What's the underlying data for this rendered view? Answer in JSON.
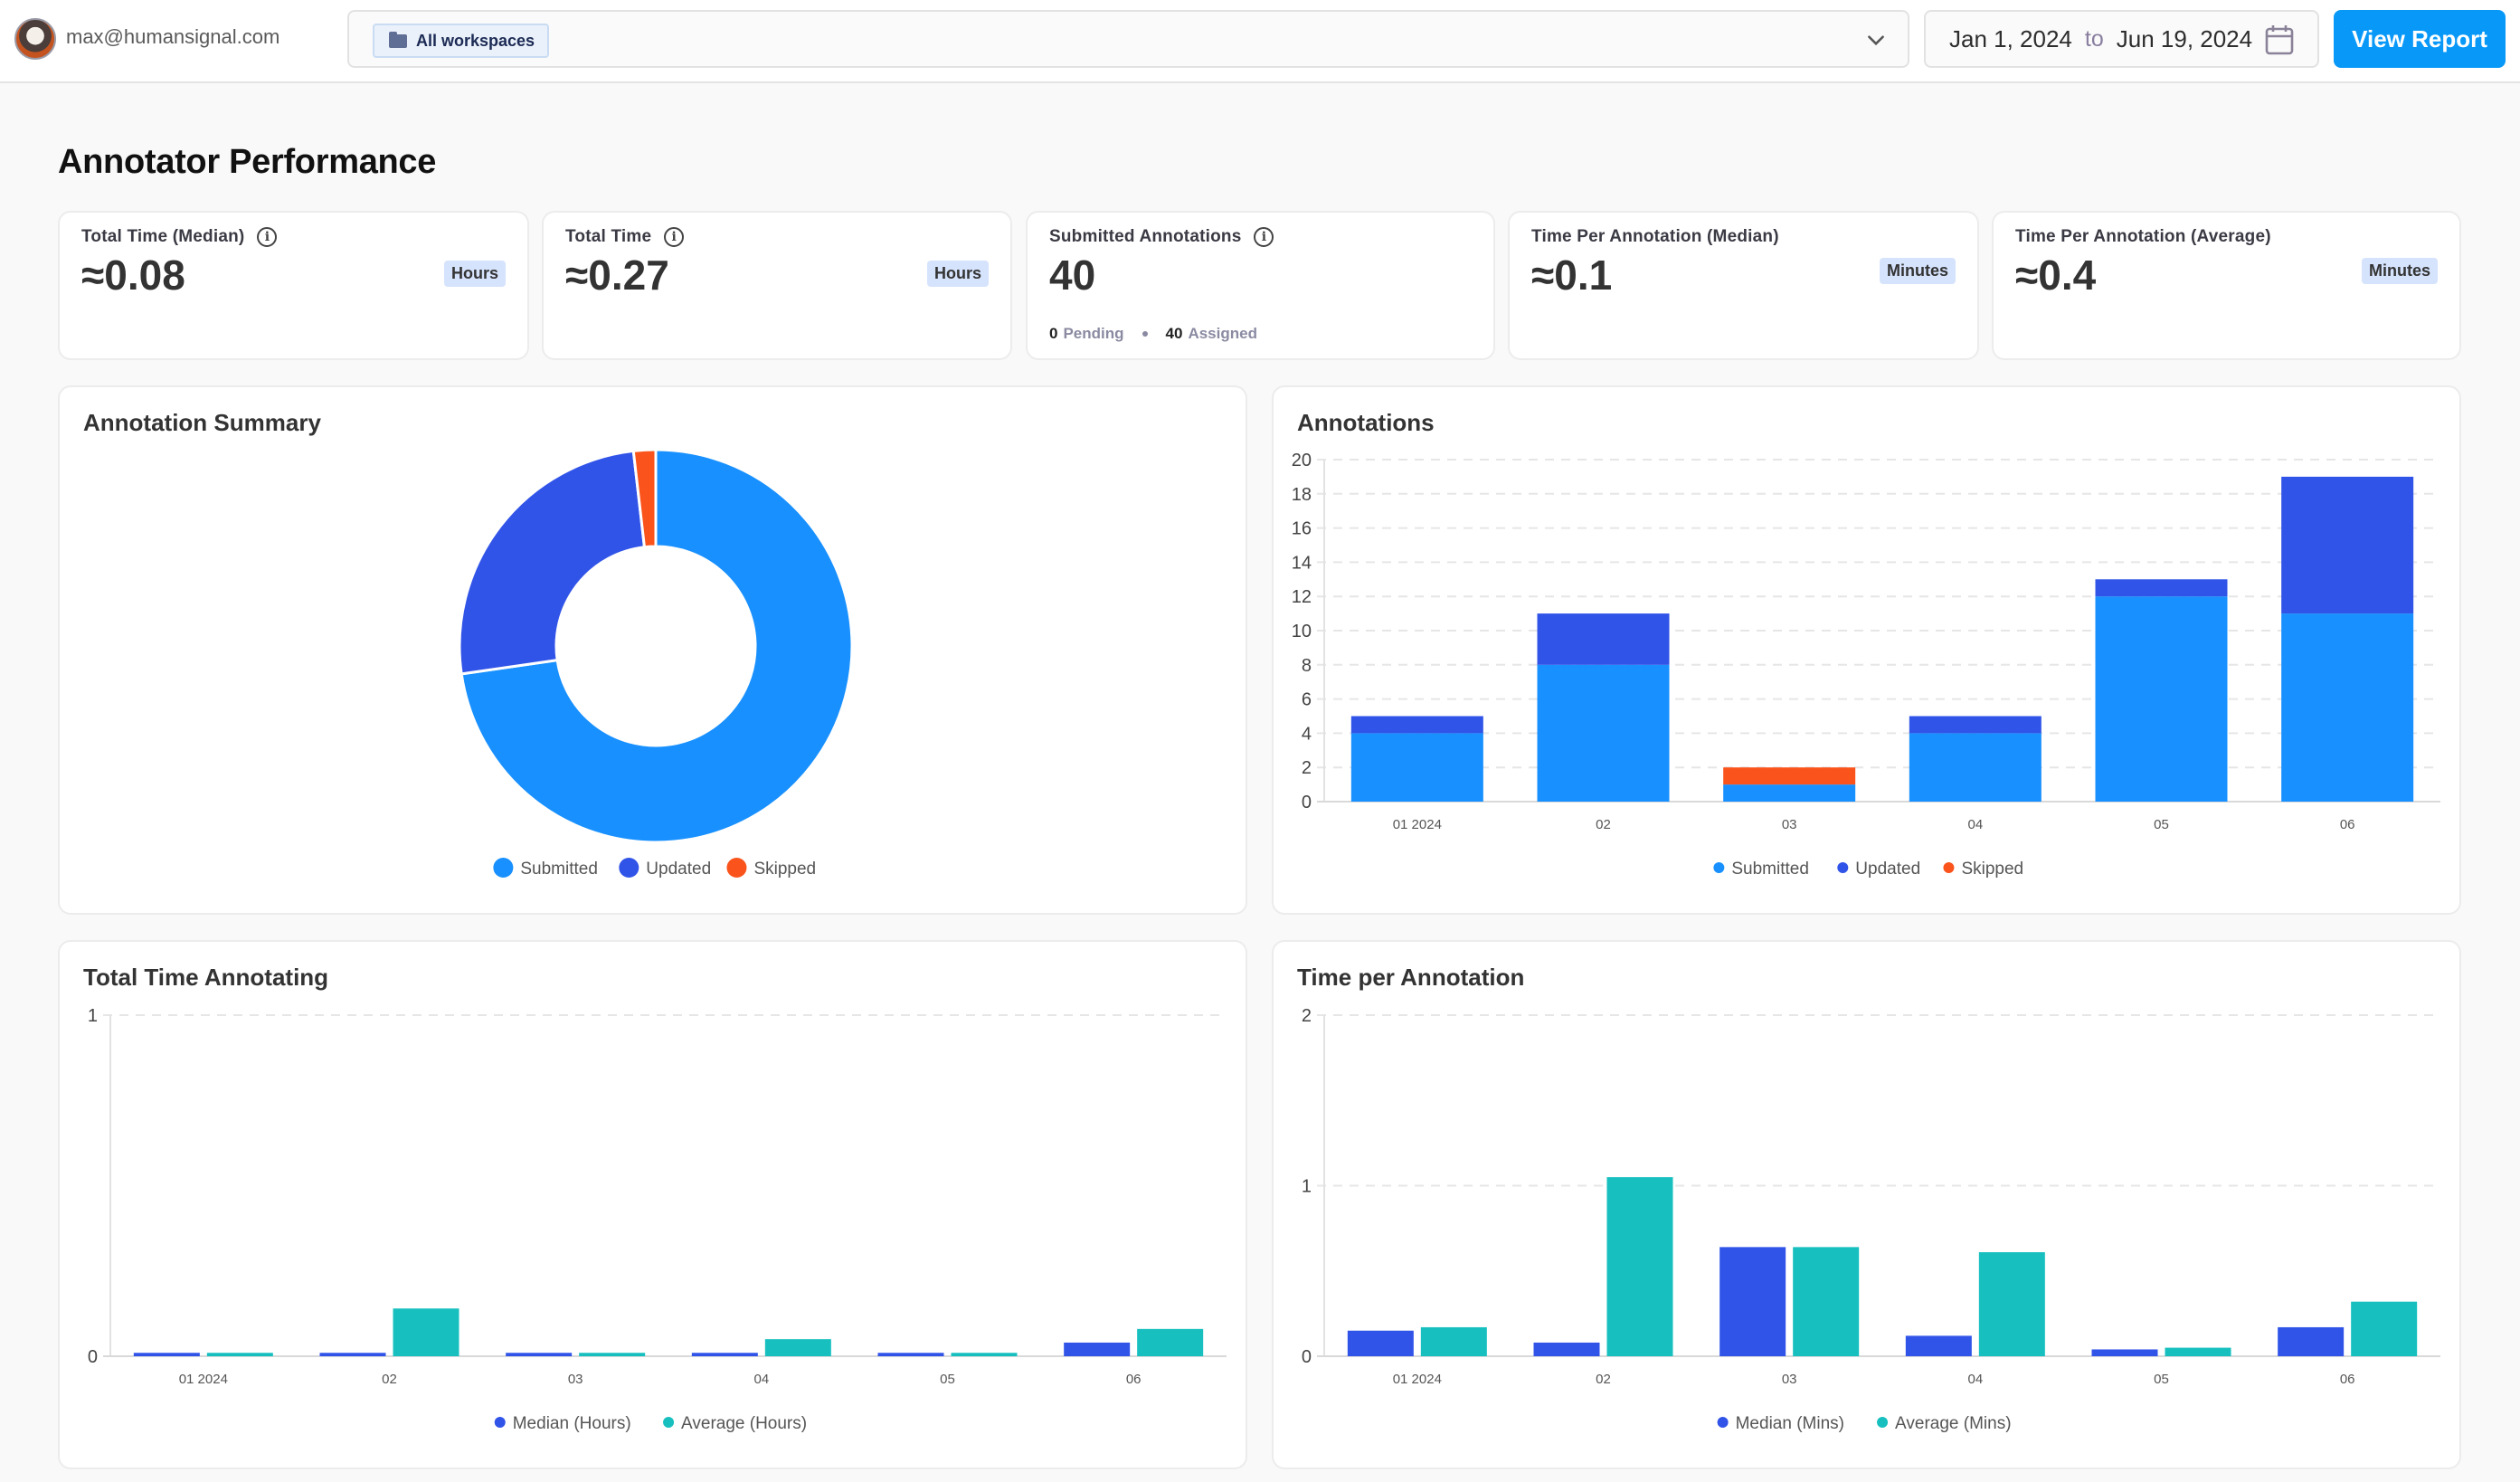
{
  "header": {
    "user_email": "max@humansignal.com",
    "workspace_chip": "All workspaces",
    "date_from": "Jan 1, 2024",
    "date_to_word": "to",
    "date_to": "Jun 19, 2024",
    "view_report_label": "View Report"
  },
  "page": {
    "title": "Annotator Performance"
  },
  "kpis": [
    {
      "label": "Total Time (Median)",
      "value": "≈0.08",
      "unit": "Hours",
      "info": true
    },
    {
      "label": "Total Time",
      "value": "≈0.27",
      "unit": "Hours",
      "info": true
    },
    {
      "label": "Submitted Annotations",
      "value": "40",
      "info": true,
      "pending_count": "0",
      "pending_label": "Pending",
      "assigned_count": "40",
      "assigned_label": "Assigned"
    },
    {
      "label": "Time Per Annotation (Median)",
      "value": "≈0.1",
      "unit": "Minutes",
      "info": false
    },
    {
      "label": "Time Per Annotation (Average)",
      "value": "≈0.4",
      "unit": "Minutes",
      "info": false
    }
  ],
  "colors": {
    "submitted": "#1890ff",
    "updated": "#3154e8",
    "skipped": "#fa541c",
    "median": "#3154e8",
    "average": "#17c0bf",
    "accent": "#0898f8"
  },
  "chart_data": [
    {
      "id": "annotation-summary",
      "type": "pie",
      "title": "Annotation Summary",
      "donut": true,
      "labels": [
        "Submitted",
        "Updated",
        "Skipped"
      ],
      "values": [
        40,
        14,
        1
      ],
      "legend": "bottom"
    },
    {
      "id": "annotations",
      "type": "bar",
      "stacked": true,
      "title": "Annotations",
      "categories": [
        "01 2024",
        "02",
        "03",
        "04",
        "05",
        "06"
      ],
      "series": [
        {
          "name": "Submitted",
          "values": [
            4,
            8,
            1,
            4,
            12,
            11
          ]
        },
        {
          "name": "Updated",
          "values": [
            1,
            3,
            0,
            1,
            1,
            8
          ]
        },
        {
          "name": "Skipped",
          "values": [
            0,
            0,
            1,
            0,
            0,
            0
          ]
        }
      ],
      "yticks": [
        0,
        2,
        4,
        6,
        8,
        10,
        12,
        14,
        16,
        18,
        20
      ],
      "ylim": [
        0,
        20
      ],
      "grid": true,
      "legend": "bottom"
    },
    {
      "id": "total-time-annotating",
      "type": "bar",
      "title": "Total Time Annotating",
      "categories": [
        "01 2024",
        "02",
        "03",
        "04",
        "05",
        "06"
      ],
      "series": [
        {
          "name": "Median (Hours)",
          "values": [
            0.01,
            0.01,
            0.01,
            0.01,
            0.01,
            0.04
          ]
        },
        {
          "name": "Average (Hours)",
          "values": [
            0.01,
            0.14,
            0.01,
            0.05,
            0.01,
            0.08
          ]
        }
      ],
      "yticks": [
        0,
        1
      ],
      "ylim": [
        0,
        1
      ],
      "grid": true,
      "legend": "bottom"
    },
    {
      "id": "time-per-annotation",
      "type": "bar",
      "title": "Time per Annotation",
      "categories": [
        "01 2024",
        "02",
        "03",
        "04",
        "05",
        "06"
      ],
      "series": [
        {
          "name": "Median (Mins)",
          "values": [
            0.15,
            0.08,
            0.64,
            0.12,
            0.04,
            0.17
          ]
        },
        {
          "name": "Average (Mins)",
          "values": [
            0.17,
            1.05,
            0.64,
            0.61,
            0.05,
            0.32
          ]
        }
      ],
      "yticks": [
        0,
        1,
        2
      ],
      "ylim": [
        0,
        2
      ],
      "grid": true,
      "legend": "bottom"
    }
  ]
}
